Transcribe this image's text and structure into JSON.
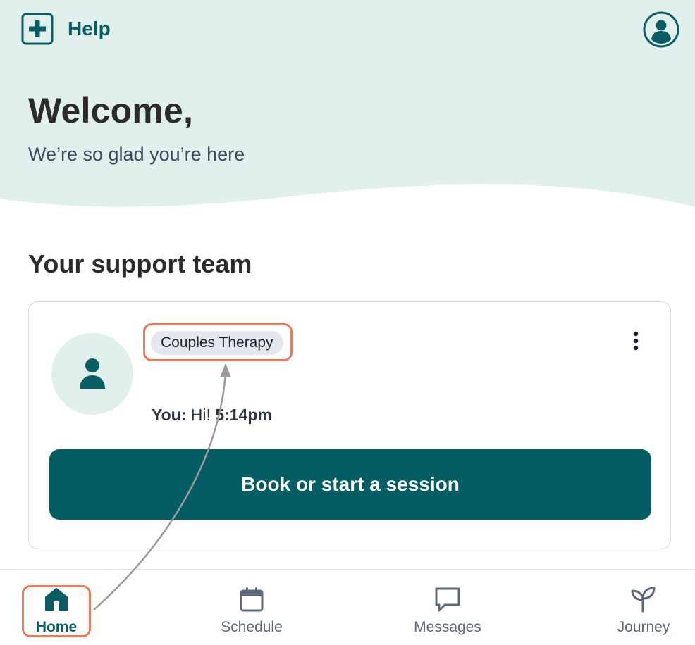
{
  "header": {
    "help_label": "Help",
    "help_icon": "plus-square-icon",
    "profile_icon": "user-circle-icon"
  },
  "hero": {
    "title": "Welcome,",
    "subtitle": "We’re so glad you’re here"
  },
  "support_team": {
    "section_title": "Your support team",
    "card": {
      "tag": "Couples Therapy",
      "last_message_sender": "You:",
      "last_message_text": "Hi!",
      "last_message_time": "5:14pm",
      "book_button_label": "Book or start a session",
      "avatar_icon": "person-icon",
      "menu_icon": "more-vertical-icon"
    }
  },
  "bottom_nav": {
    "items": [
      {
        "label": "Home",
        "icon": "home-icon",
        "active": true
      },
      {
        "label": "Schedule",
        "icon": "calendar-icon",
        "active": false
      },
      {
        "label": "Messages",
        "icon": "message-icon",
        "active": false
      },
      {
        "label": "Journey",
        "icon": "sprout-icon",
        "active": false
      }
    ]
  },
  "colors": {
    "brand": "#045d63",
    "hero_bg": "#e1efed",
    "highlight": "#ec7a56",
    "tag_bg": "#e4e7ef"
  }
}
